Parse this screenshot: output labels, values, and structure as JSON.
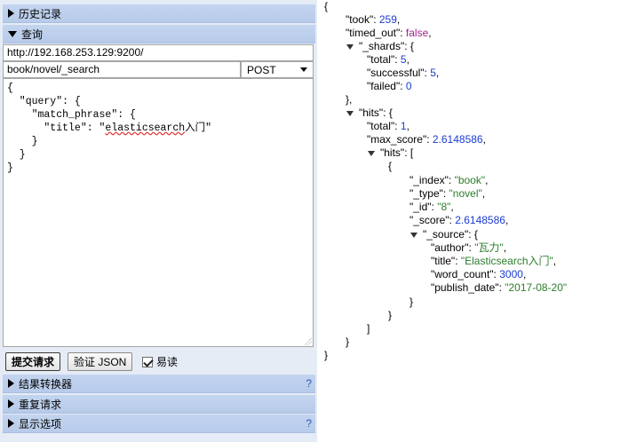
{
  "sections": {
    "history": "历史记录",
    "query": "查询",
    "result_transformer": "结果转换器",
    "repeat_request": "重复请求",
    "display_options": "显示选项",
    "help_mark": "?"
  },
  "request": {
    "url": "http://192.168.253.129:9200/",
    "path": "book/novel/_search",
    "method": "POST",
    "body_lines": [
      "{",
      "  \"query\": {",
      "    \"match_phrase\": {",
      "      \"title\": \"",
      "    }",
      "  }",
      "}"
    ],
    "title_value": "elasticsearch",
    "title_suffix": "入门\""
  },
  "buttons": {
    "submit": "提交请求",
    "validate": "验证 JSON",
    "pretty": "易读",
    "pretty_checked": true
  },
  "response": {
    "took": "259",
    "timed_out": "false",
    "shards_total": "5",
    "shards_successful": "5",
    "shards_failed": "0",
    "hits_total": "1",
    "max_score": "2.6148586",
    "index": "\"book\"",
    "type": "\"novel\"",
    "id": "\"8\"",
    "score": "2.6148586",
    "author": "\"瓦力\"",
    "title": "\"Elasticsearch入门\"",
    "word_count": "3000",
    "publish_date": "\"2017-08-20\""
  },
  "colors": {
    "panel_bg": "#e5ecf6",
    "header_bg": "#bccfec",
    "string": "#2c7d2c",
    "number": "#1b3bd1",
    "boolean": "#a0208a",
    "help": "#2a5db0"
  }
}
